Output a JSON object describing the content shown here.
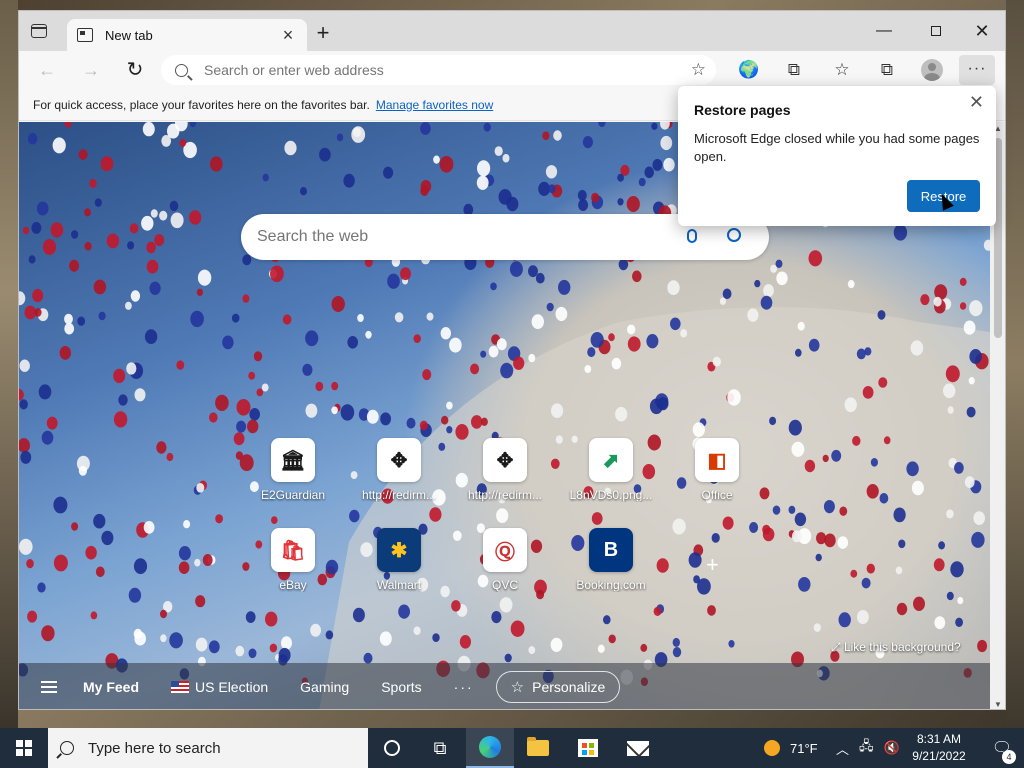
{
  "browser": {
    "tab_title": "New tab",
    "address_placeholder": "Search or enter web address",
    "favbar_text": "For quick access, place your favorites here on the favorites bar.",
    "favbar_link": "Manage favorites now"
  },
  "newtab": {
    "search_placeholder": "Search the web",
    "quick_links": [
      {
        "label": "E2Guardian",
        "icon": "museum-icon"
      },
      {
        "label": "http://redirm...",
        "icon": "move-arrows-icon"
      },
      {
        "label": "http://redirm...",
        "icon": "move-arrows-icon"
      },
      {
        "label": "L8nVDs0.png...",
        "icon": "image-icon"
      },
      {
        "label": "Office",
        "icon": "office-icon"
      },
      {
        "label": "eBay",
        "icon": "shopping-bag-icon"
      },
      {
        "label": "Walmart",
        "icon": "walmart-icon"
      },
      {
        "label": "QVC",
        "icon": "qvc-icon"
      },
      {
        "label": "Booking.com",
        "icon": "booking-icon"
      }
    ],
    "like_background": "Like this background?",
    "feed": {
      "my_feed": "My Feed",
      "items": [
        "US Election",
        "Gaming",
        "Sports"
      ],
      "more": "···",
      "personalize": "Personalize"
    }
  },
  "popup": {
    "title": "Restore pages",
    "body": "Microsoft Edge closed while you had some pages open.",
    "button": "Restore"
  },
  "taskbar": {
    "search_placeholder": "Type here to search",
    "weather": "71°F",
    "time": "8:31 AM",
    "date": "9/21/2022",
    "notification_count": "4"
  },
  "colors": {
    "accent": "#0f6cbd",
    "taskbar": "#1f2d3d"
  }
}
